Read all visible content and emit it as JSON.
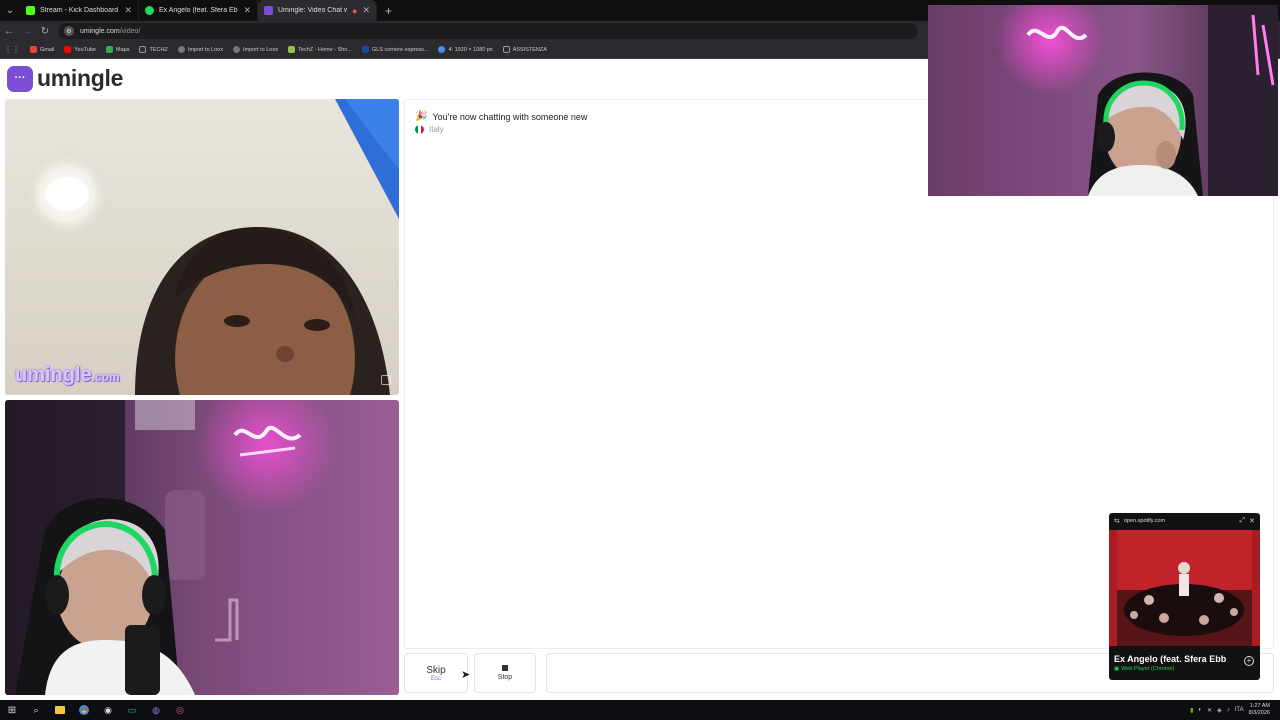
{
  "browser": {
    "tabs": [
      {
        "title": "Stream - Kick Dashboard",
        "color": "#53fc18",
        "active": false
      },
      {
        "title": "Ex Angelo (feat. Sfera Ebb...",
        "color": "#1ed760",
        "active": false
      },
      {
        "title": "Umingle: Video Chat with S...",
        "color": "#7a4fd6",
        "active": true
      }
    ],
    "new_tab": "+",
    "url_host": "umingle.com",
    "url_path": "/video/",
    "bookmarks": [
      {
        "label": "Gmail",
        "color": "#ea4335"
      },
      {
        "label": "YouTube",
        "color": "#ff0000"
      },
      {
        "label": "Maps",
        "color": "#34a853"
      },
      {
        "label": "TECHZ",
        "color": "#888888"
      },
      {
        "label": "Import to Loox",
        "color": "#aaaaaa"
      },
      {
        "label": "Import to Loox",
        "color": "#aaaaaa"
      },
      {
        "label": "TechZ - Home - Sho...",
        "color": "#95bf47"
      },
      {
        "label": "GLS corriere espress...",
        "color": "#1a4b9b"
      },
      {
        "label": "4: 1920 × 1080 px",
        "color": "#4a90e2"
      },
      {
        "label": "ASSISTENZA",
        "color": "#888888"
      }
    ]
  },
  "site": {
    "logo_text": "umingle",
    "watermark_main": "umingle",
    "watermark_tld": ".com"
  },
  "chat": {
    "emoji": "🎉",
    "message": "You're now chatting with someone new",
    "country": "Italy"
  },
  "controls": {
    "skip_label": "Skip",
    "skip_hint": "Esc",
    "stop_label": "Stop"
  },
  "spotify": {
    "domain": "open.spotify.com",
    "track_title": "Ex Angelo (feat. Sfera Ebb",
    "source": "Web Player (Chrome)"
  },
  "taskbar": {
    "time": "1:27 AM",
    "date": "8/3/2026",
    "lang": "ITA"
  },
  "colors": {
    "brand": "#7a4fd6",
    "spotify_green": "#1ed760"
  }
}
